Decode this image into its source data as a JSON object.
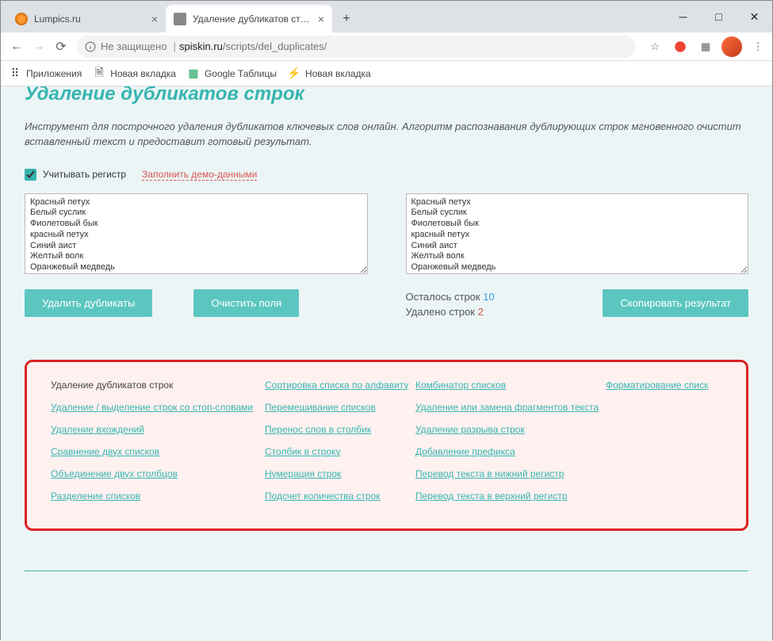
{
  "window": {
    "tabs": [
      {
        "label": "Lumpics.ru",
        "active": false
      },
      {
        "label": "Удаление дубликатов строк - уд",
        "active": true
      }
    ]
  },
  "address": {
    "not_secure": "Не защищено",
    "domain": "spiskin.ru",
    "path": "/scripts/del_duplicates/"
  },
  "bookmarks": {
    "apps": "Приложения",
    "newtab1": "Новая вкладка",
    "sheets": "Google Таблицы",
    "newtab2": "Новая вкладка"
  },
  "page": {
    "title": "Удаление дубликатов строк",
    "desc": "Инструмент для построчного удаления дубликатов ключевых слов онлайн. Алгоритм распознавания дублирующих строк мгновенного очистит вставленный текст и предоставит готовый результат.",
    "checkbox_label": "Учитывать регистр",
    "demo_link": "Заполнить демо-данными",
    "input_text": "Красный петух\nБелый суслик\nФиолетовый бык\nкрасный петух\nСиний аист\nЖелтый волк\nОранжевый медведь\nСиний аист",
    "output_text": "Красный петух\nБелый суслик\nФиолетовый бык\nкрасный петух\nСиний аист\nЖелтый волк\nОранжевый медведь\nЧерный страус",
    "btn_remove": "Удалить дубликаты",
    "btn_clear": "Очистить поля",
    "btn_copy": "Скопировать результат",
    "stats_left_label": "Осталось строк ",
    "stats_left_num": "10",
    "stats_removed_label": "Удалено строк ",
    "stats_removed_num": "2"
  },
  "links": {
    "col1": [
      "Удаление дубликатов строк",
      "Удаление / выделение строк со стоп-словами",
      "Удаление вхождений",
      "Сравнение двух списков",
      "Объединение двух столбцов",
      "Разделение списков"
    ],
    "col2": [
      "Сортировка списка по алфавиту",
      "Перемешивание списков",
      "Перенос слов в столбик",
      "Столбик в строку",
      "Нумерация строк",
      "Подсчет количества строк"
    ],
    "col3": [
      "Комбинатор списков",
      "Удаление или замена фрагментов текста",
      "Удаление разрыва строк",
      "Добавление префикса",
      "Перевод текста в нижний регистр",
      "Перевод текста в верхний регистр"
    ],
    "col4": [
      "Форматирование списк"
    ]
  }
}
